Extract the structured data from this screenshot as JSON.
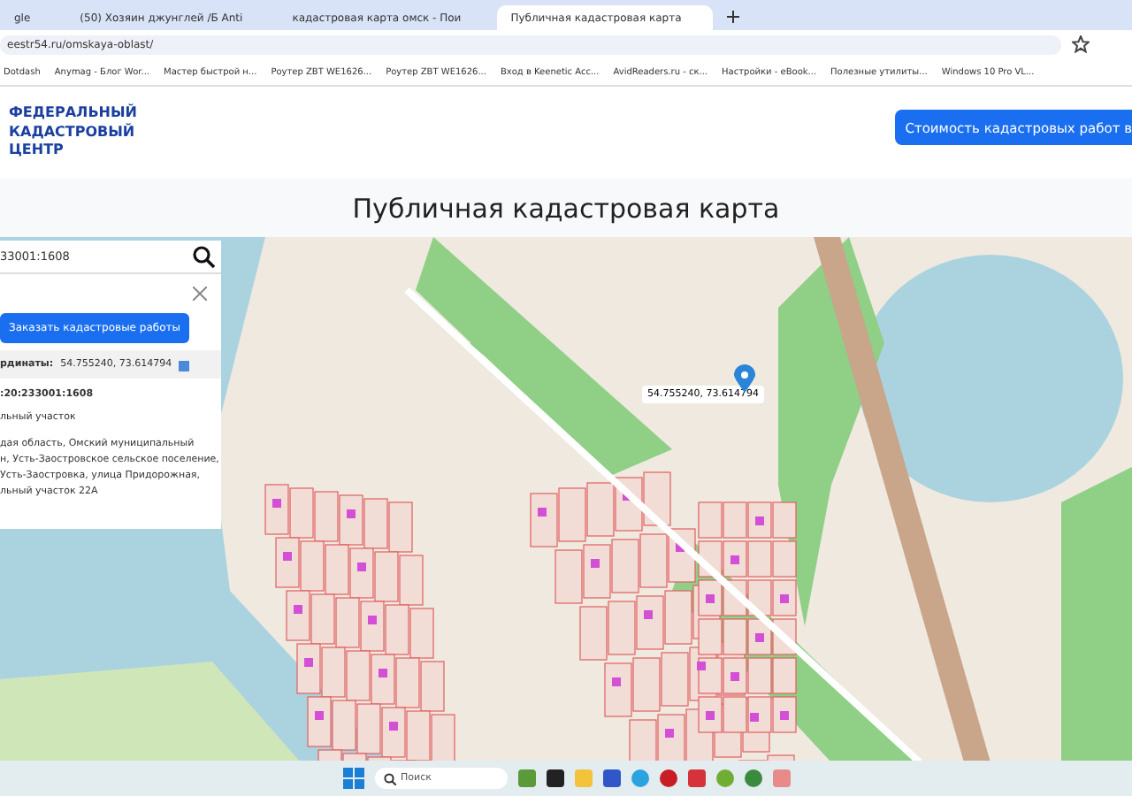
{
  "browser": {
    "tabs": [
      {
        "title": "gle",
        "selected": false
      },
      {
        "title": "(50) Хозяин джунглей /Б Anti",
        "selected": false
      },
      {
        "title": "кадастровая карта омск - Пои",
        "selected": false
      },
      {
        "title": "Публичная кадастровая карта",
        "selected": true
      }
    ],
    "address": "eestr54.ru/omskaya-oblast/",
    "bookmarks": [
      "Dotdash",
      "Anymag - Блог Wor...",
      "Мастер быстрой н...",
      "Роутер ZBT WE1626...",
      "Роутер ZBT WE1626...",
      "Вход в Keenetic Acc...",
      "AvidReaders.ru - ск...",
      "Настройки - eBook...",
      "Полезные утилиты...",
      "Windows 10 Pro VL..."
    ]
  },
  "site": {
    "logo": [
      "ФЕДЕРАЛЬНЫЙ",
      "КАДАСТРОВЫЙ",
      "ЦЕНТР"
    ],
    "header_button": "Стоимость кадастровых работ в",
    "title": "Публичная кадастровая карта"
  },
  "map_panel": {
    "search_value": "33001:1608",
    "order_button": "Заказать кадастровые работы",
    "coords_label": "рдинаты:",
    "coords_value": "54.755240, 73.614794",
    "cadastral_number": ":20:233001:1608",
    "type": "льный участок",
    "address": [
      "дая область, Омский муниципальный",
      "н, Усть-Заостровское сельское поселение,",
      "Усть-Заостровка, улица Придорожная,",
      "льный участок 22А"
    ]
  },
  "map": {
    "tooltip": "54.755240, 73.614794"
  },
  "taskbar": {
    "search_placeholder": "Поиск"
  }
}
